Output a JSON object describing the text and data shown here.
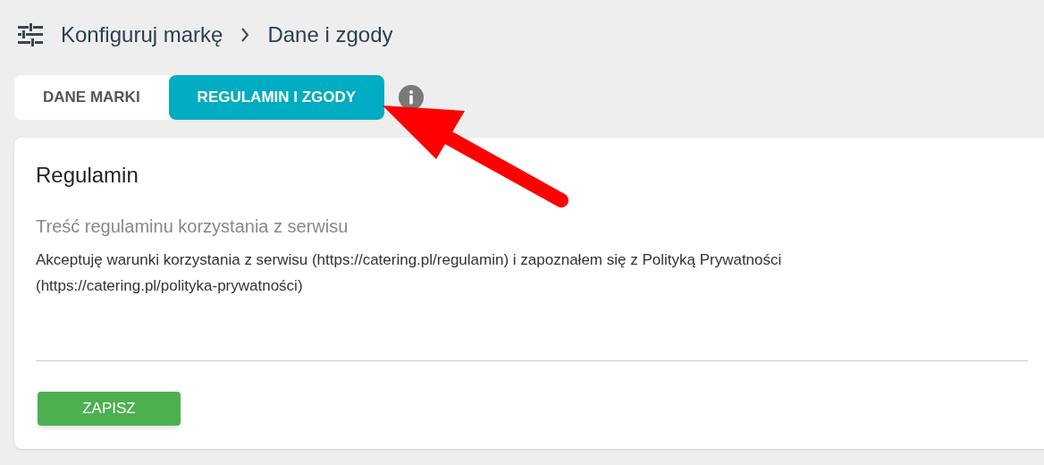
{
  "breadcrumb": {
    "items": [
      "Konfiguruj markę",
      "Dane i zgody"
    ]
  },
  "tabs": [
    {
      "label": "DANE MARKI",
      "selected": false
    },
    {
      "label": "REGULAMIN I ZGODY",
      "selected": true
    }
  ],
  "card": {
    "title": "Regulamin",
    "field": {
      "label": "Treść regulaminu korzystania z serwisu",
      "value": "Akceptuję warunki korzystania z serwisu (https://catering.pl/regulamin) i zapoznałem się z Polityką Prywatności (https://catering.pl/polityka-prywatności)"
    },
    "button": "ZAPISZ"
  }
}
